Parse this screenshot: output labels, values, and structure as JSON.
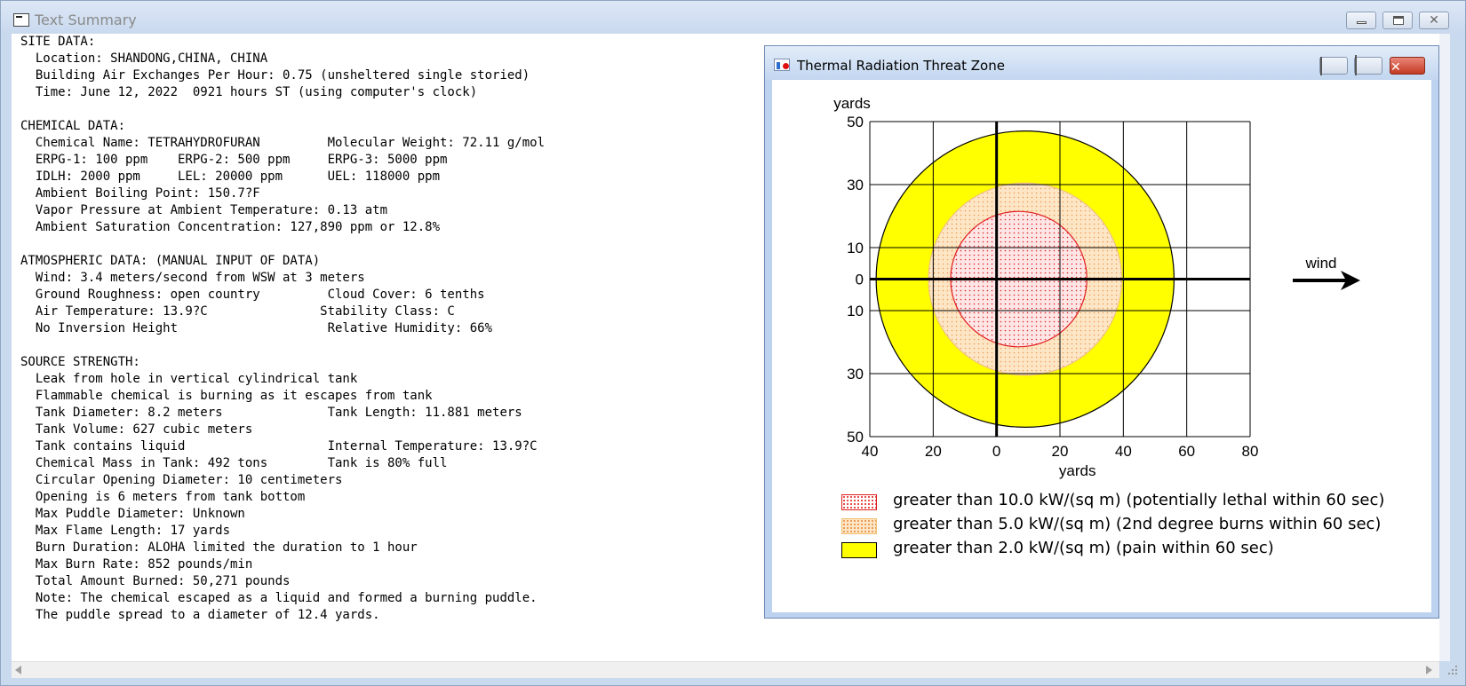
{
  "window": {
    "title": "Text Summary"
  },
  "summary_lines": [
    "SITE DATA:",
    "  Location: SHANDONG,CHINA, CHINA",
    "  Building Air Exchanges Per Hour: 0.75 (unsheltered single storied)",
    "  Time: June 12, 2022  0921 hours ST (using computer's clock)",
    "",
    "CHEMICAL DATA:",
    "  Chemical Name: TETRAHYDROFURAN         Molecular Weight: 72.11 g/mol",
    "  ERPG-1: 100 ppm    ERPG-2: 500 ppm     ERPG-3: 5000 ppm",
    "  IDLH: 2000 ppm     LEL: 20000 ppm      UEL: 118000 ppm",
    "  Ambient Boiling Point: 150.7?F",
    "  Vapor Pressure at Ambient Temperature: 0.13 atm",
    "  Ambient Saturation Concentration: 127,890 ppm or 12.8%",
    "",
    "ATMOSPHERIC DATA: (MANUAL INPUT OF DATA)",
    "  Wind: 3.4 meters/second from WSW at 3 meters",
    "  Ground Roughness: open country         Cloud Cover: 6 tenths",
    "  Air Temperature: 13.9?C               Stability Class: C",
    "  No Inversion Height                    Relative Humidity: 66%",
    "",
    "SOURCE STRENGTH:",
    "  Leak from hole in vertical cylindrical tank",
    "  Flammable chemical is burning as it escapes from tank",
    "  Tank Diameter: 8.2 meters              Tank Length: 11.881 meters",
    "  Tank Volume: 627 cubic meters",
    "  Tank contains liquid                   Internal Temperature: 13.9?C",
    "  Chemical Mass in Tank: 492 tons        Tank is 80% full",
    "  Circular Opening Diameter: 10 centimeters",
    "  Opening is 6 meters from tank bottom",
    "  Max Puddle Diameter: Unknown",
    "  Max Flame Length: 17 yards",
    "  Burn Duration: ALOHA limited the duration to 1 hour",
    "  Max Burn Rate: 852 pounds/min",
    "  Total Amount Burned: 50,271 pounds",
    "  Note: The chemical escaped as a liquid and formed a burning puddle.",
    "  The puddle spread to a diameter of 12.4 yards."
  ],
  "threat_window": {
    "title": "Thermal Radiation Threat Zone"
  },
  "icons": {
    "app": "document-icon",
    "chart_window": "threat-zone-chart-icon",
    "minimize": "minimize-icon",
    "maximize": "maximize-icon",
    "close": "close-icon",
    "wind": "wind-arrow-icon"
  },
  "colors": {
    "lethal_zone": "#ffe6e6",
    "lethal_border": "#e02020",
    "burns_zone": "#fde6c6",
    "burns_border": "#f0a050",
    "pain_zone": "#ffff00",
    "pain_border": "#000000"
  },
  "chart_data": {
    "type": "threat-zone",
    "x_ticks": [
      "40",
      "20",
      "0",
      "20",
      "40",
      "60",
      "80"
    ],
    "x_values": [
      -40,
      -20,
      0,
      20,
      40,
      60,
      80
    ],
    "y_ticks": [
      "50",
      "30",
      "10",
      "0",
      "10",
      "30",
      "50"
    ],
    "y_values": [
      50,
      30,
      10,
      0,
      -10,
      -30,
      -50
    ],
    "grid_x": [
      -40,
      -20,
      0,
      20,
      40,
      60,
      80
    ],
    "grid_y": [
      50,
      30,
      10,
      -10,
      -30,
      -50
    ],
    "xlim": [
      -40,
      80
    ],
    "ylim": [
      -50,
      50
    ],
    "xlabel": "yards",
    "ylabel": "yards",
    "wind_label": "wind",
    "zones": [
      {
        "name": "pain",
        "cx": 9,
        "cy": 0,
        "r": 47,
        "fill": "#ffff00",
        "stroke": "#000000",
        "pattern": "none"
      },
      {
        "name": "burns",
        "cx": 9,
        "cy": 0,
        "r": 30.5,
        "fill": "#fde6c6",
        "stroke": "#f0c080",
        "pattern": "burns-dots"
      },
      {
        "name": "lethal",
        "cx": 7,
        "cy": 0,
        "r": 21.5,
        "fill": "#ffe6e6",
        "stroke": "#e02020",
        "pattern": "lethal-dots"
      }
    ],
    "legend": [
      {
        "swatch": "lethal",
        "label": "greater than 10.0 kW/(sq m) (potentially lethal within 60 sec)"
      },
      {
        "swatch": "burns",
        "label": "greater than 5.0 kW/(sq m) (2nd degree burns within 60 sec)"
      },
      {
        "swatch": "pain",
        "label": "greater than 2.0 kW/(sq m) (pain within 60 sec)"
      }
    ]
  }
}
